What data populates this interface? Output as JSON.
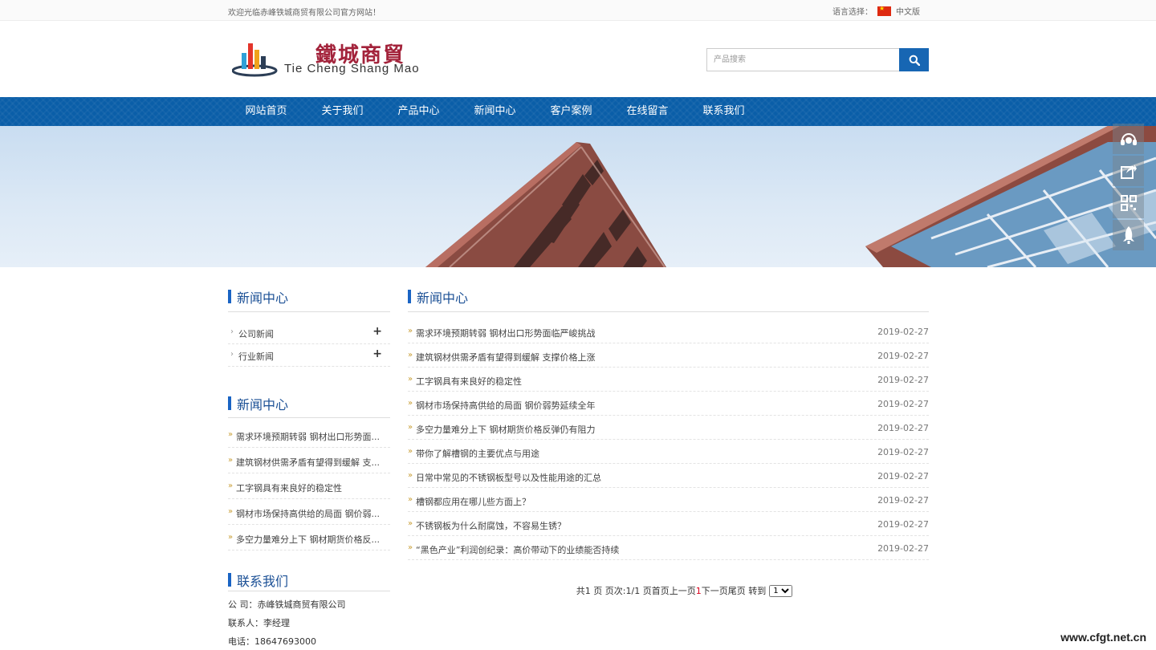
{
  "topbar": {
    "welcome": "欢迎光临赤峰铁城商贸有限公司官方网站！",
    "lang_label": "语言选择：",
    "lang_current": "中文版"
  },
  "header": {
    "logo_cn": "鐵城商貿",
    "logo_en": "Tie Cheng Shang Mao",
    "search_placeholder": "产品搜索"
  },
  "nav": {
    "items": [
      "网站首页",
      "关于我们",
      "产品中心",
      "新闻中心",
      "客户案例",
      "在线留言",
      "联系我们"
    ]
  },
  "sidebar": {
    "section1_title": "新闻中心",
    "categories": [
      "公司新闻",
      "行业新闻"
    ],
    "section2_title": "新闻中心",
    "recent_news": [
      "需求环境预期转弱 钢材出口形势面...",
      "建筑钢材供需矛盾有望得到缓解 支...",
      "工字钢具有来良好的稳定性",
      "钢材市场保持高供给的局面 钢价弱...",
      "多空力量难分上下 钢材期货价格反..."
    ],
    "section3_title": "联系我们",
    "contact": {
      "company": "公 司：赤峰铁城商贸有限公司",
      "person": "联系人：李经理",
      "phone": "电话：18647693000"
    }
  },
  "main": {
    "title": "新闻中心",
    "news": [
      {
        "title": "需求环境预期转弱 钢材出口形势面临严峻挑战",
        "date": "2019-02-27"
      },
      {
        "title": "建筑钢材供需矛盾有望得到缓解 支撑价格上涨",
        "date": "2019-02-27"
      },
      {
        "title": "工字钢具有来良好的稳定性",
        "date": "2019-02-27"
      },
      {
        "title": "钢材市场保持高供给的局面 钢价弱势延续全年",
        "date": "2019-02-27"
      },
      {
        "title": "多空力量难分上下 钢材期货价格反弹仍有阻力",
        "date": "2019-02-27"
      },
      {
        "title": "带你了解槽钢的主要优点与用途",
        "date": "2019-02-27"
      },
      {
        "title": "日常中常见的不锈钢板型号以及性能用途的汇总",
        "date": "2019-02-27"
      },
      {
        "title": "槽钢都应用在哪儿些方面上？",
        "date": "2019-02-27"
      },
      {
        "title": "不锈钢板为什么耐腐蚀，不容易生锈？",
        "date": "2019-02-27"
      },
      {
        "title": "“黑色产业”利润创纪录：高价带动下的业绩能否持续",
        "date": "2019-02-27"
      }
    ],
    "pager": {
      "prefix": "共1 页 页次:1/1 页首页上一页",
      "current": "1",
      "suffix": "下一页尾页 转到",
      "select_value": "1"
    }
  },
  "watermark": "www.cfgt.net.cn",
  "colors": {
    "nav_bg": "#0a5ea8",
    "accent": "#1a64c4",
    "logo_red": "#a3233b"
  }
}
